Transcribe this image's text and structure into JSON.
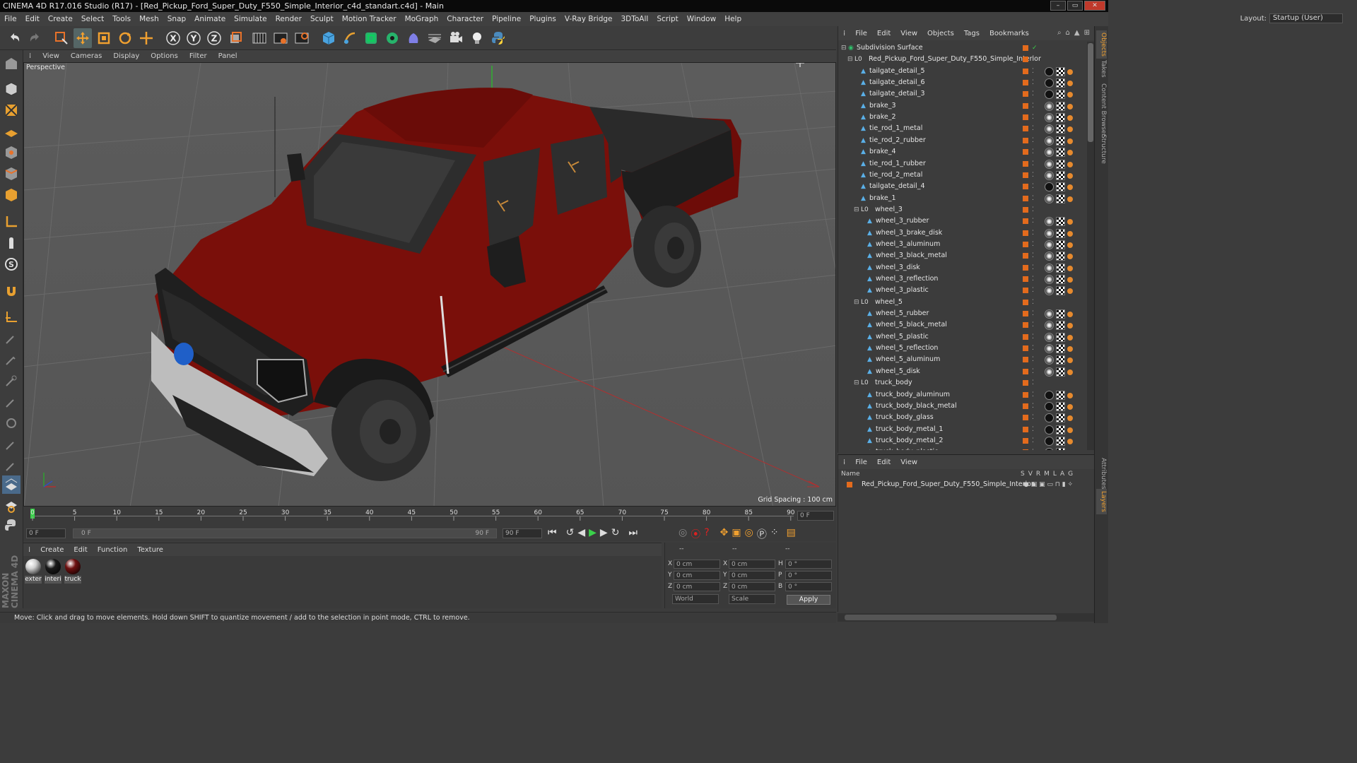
{
  "window": {
    "title": "CINEMA 4D R17.016 Studio (R17) - [Red_Pickup_Ford_Super_Duty_F550_Simple_Interior_c4d_standart.c4d] - Main",
    "buttons": [
      "–",
      "▭",
      "✕"
    ]
  },
  "menubar": {
    "items": [
      "File",
      "Edit",
      "Create",
      "Select",
      "Tools",
      "Mesh",
      "Snap",
      "Animate",
      "Simulate",
      "Render",
      "Sculpt",
      "Motion Tracker",
      "MoGraph",
      "Character",
      "Pipeline",
      "Plugins",
      "V-Ray Bridge",
      "3DToAll",
      "Script",
      "Window",
      "Help"
    ],
    "layout_label": "Layout:",
    "layout_value": "Startup (User)"
  },
  "toolbar": {
    "icons": [
      "undo-icon",
      "redo-icon",
      "live-selection-icon",
      "move-icon",
      "scale-icon",
      "rotate-icon",
      "move-axis-icon",
      "x-axis-icon",
      "y-axis-icon",
      "z-axis-icon",
      "coordinate-system-icon",
      "render-view-icon",
      "render-picture-viewer-icon",
      "render-settings-icon",
      "cube-icon",
      "pen-icon",
      "subdivision-icon",
      "array-icon",
      "deformer-icon",
      "floor-icon",
      "camera-icon",
      "light-icon",
      "python-icon"
    ],
    "axis_labels": [
      "X",
      "Y",
      "Z"
    ]
  },
  "viewport": {
    "menu": [
      "View",
      "Cameras",
      "Display",
      "Options",
      "Filter",
      "Panel"
    ],
    "label": "Perspective",
    "grid_spacing": "Grid Spacing : 100 cm"
  },
  "timeline": {
    "ticks": [
      "0",
      "5",
      "10",
      "15",
      "20",
      "25",
      "30",
      "35",
      "40",
      "45",
      "50",
      "55",
      "60",
      "65",
      "70",
      "75",
      "80",
      "85",
      "90"
    ],
    "current_frame_right": "0 F",
    "start_field": "0 F",
    "range_start": "0 F",
    "range_end": "90 F",
    "end_field": "90 F"
  },
  "materials": {
    "menu": [
      "Create",
      "Edit",
      "Function",
      "Texture"
    ],
    "items": [
      {
        "label": "exter",
        "color": "#cfcfcf"
      },
      {
        "label": "interi",
        "color": "#1a1a1a"
      },
      {
        "label": "truck",
        "color": "#6e1010"
      }
    ]
  },
  "coords": {
    "headers": [
      "--",
      "--",
      "--"
    ],
    "rows": [
      {
        "a": "X",
        "v1": "0 cm",
        "b": "X",
        "v2": "0 cm",
        "c": "H",
        "v3": "0 °"
      },
      {
        "a": "Y",
        "v1": "0 cm",
        "b": "Y",
        "v2": "0 cm",
        "c": "P",
        "v3": "0 °"
      },
      {
        "a": "Z",
        "v1": "0 cm",
        "b": "Z",
        "v2": "0 cm",
        "c": "B",
        "v3": "0 °"
      }
    ],
    "mode1": "World",
    "mode2": "Scale",
    "apply": "Apply"
  },
  "status": "Move: Click and drag to move elements. Hold down SHIFT to quantize movement / add to the selection in point mode, CTRL to remove.",
  "objects": {
    "menu": [
      "File",
      "Edit",
      "View",
      "Objects",
      "Tags",
      "Bookmarks"
    ],
    "rows": [
      {
        "name": "Subdivision Surface",
        "level": 0,
        "tags": "none"
      },
      {
        "name": "Red_Pickup_Ford_Super_Duty_F550_Simple_Interior",
        "level": 1,
        "tags": "none"
      },
      {
        "name": "tailgate_detail_5",
        "level": 2,
        "tags": "b"
      },
      {
        "name": "tailgate_detail_6",
        "level": 2,
        "tags": "b"
      },
      {
        "name": "tailgate_detail_3",
        "level": 2,
        "tags": "b"
      },
      {
        "name": "brake_3",
        "level": 2,
        "tags": "w"
      },
      {
        "name": "brake_2",
        "level": 2,
        "tags": "w"
      },
      {
        "name": "tie_rod_1_metal",
        "level": 2,
        "tags": "w"
      },
      {
        "name": "tie_rod_2_rubber",
        "level": 2,
        "tags": "w"
      },
      {
        "name": "brake_4",
        "level": 2,
        "tags": "w"
      },
      {
        "name": "tie_rod_1_rubber",
        "level": 2,
        "tags": "w"
      },
      {
        "name": "tie_rod_2_metal",
        "level": 2,
        "tags": "w"
      },
      {
        "name": "tailgate_detail_4",
        "level": 2,
        "tags": "b"
      },
      {
        "name": "brake_1",
        "level": 2,
        "tags": "w"
      },
      {
        "name": "wheel_3",
        "level": 2,
        "tags": "none"
      },
      {
        "name": "wheel_3_rubber",
        "level": 3,
        "tags": "w"
      },
      {
        "name": "wheel_3_brake_disk",
        "level": 3,
        "tags": "w"
      },
      {
        "name": "wheel_3_aluminum",
        "level": 3,
        "tags": "w"
      },
      {
        "name": "wheel_3_black_metal",
        "level": 3,
        "tags": "w"
      },
      {
        "name": "wheel_3_disk",
        "level": 3,
        "tags": "w"
      },
      {
        "name": "wheel_3_reflection",
        "level": 3,
        "tags": "w"
      },
      {
        "name": "wheel_3_plastic",
        "level": 3,
        "tags": "w"
      },
      {
        "name": "wheel_5",
        "level": 2,
        "tags": "none"
      },
      {
        "name": "wheel_5_rubber",
        "level": 3,
        "tags": "w"
      },
      {
        "name": "wheel_5_black_metal",
        "level": 3,
        "tags": "w"
      },
      {
        "name": "wheel_5_plastic",
        "level": 3,
        "tags": "w"
      },
      {
        "name": "wheel_5_reflection",
        "level": 3,
        "tags": "w"
      },
      {
        "name": "wheel_5_aluminum",
        "level": 3,
        "tags": "w"
      },
      {
        "name": "wheel_5_disk",
        "level": 3,
        "tags": "w"
      },
      {
        "name": "truck_body",
        "level": 2,
        "tags": "none"
      },
      {
        "name": "truck_body_aluminum",
        "level": 3,
        "tags": "b"
      },
      {
        "name": "truck_body_black_metal",
        "level": 3,
        "tags": "b"
      },
      {
        "name": "truck_body_glass",
        "level": 3,
        "tags": "b"
      },
      {
        "name": "truck_body_metal_1",
        "level": 3,
        "tags": "b"
      },
      {
        "name": "truck_body_metal_2",
        "level": 3,
        "tags": "b"
      },
      {
        "name": "truck_body_plastic",
        "level": 3,
        "tags": "b"
      }
    ]
  },
  "layers": {
    "menu": [
      "File",
      "Edit",
      "View"
    ],
    "col_name": "Name",
    "col_flags": [
      "S",
      "V",
      "R",
      "M",
      "L",
      "A",
      "G"
    ],
    "row": "Red_Pickup_Ford_Super_Duty_F550_Simple_Interior"
  },
  "sidetabs": [
    "Objects",
    "Takes",
    "Content Browser",
    "Structure",
    "Attributes",
    "Layers"
  ],
  "brand": "MAXON CINEMA 4D"
}
